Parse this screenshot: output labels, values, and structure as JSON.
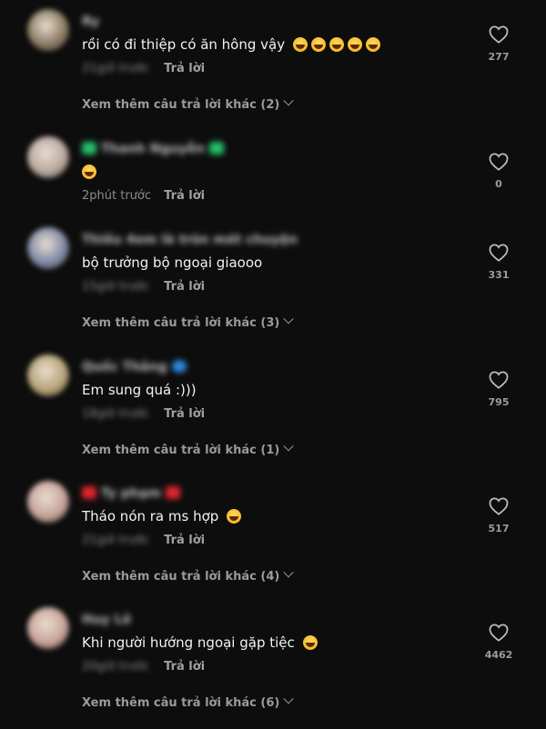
{
  "ui": {
    "reply_label": "Trả lời"
  },
  "comments": [
    {
      "author": "Ry",
      "text": "rồi có đi thiệp có ăn hông vậy",
      "emoji_count": 5,
      "time": "21giờ trước",
      "time_blurred": true,
      "likes": "277",
      "more_replies": "Xem thêm câu trả lời khác (2)",
      "avatar_color": "#8a7a62",
      "badges": []
    },
    {
      "author": "Thanh Nguyễn",
      "text": "",
      "emoji_count": 1,
      "time": "2phút trước",
      "time_blurred": false,
      "likes": "0",
      "more_replies": "",
      "avatar_color": "#b9a89f",
      "badges": [
        "#26c06a",
        "#26c06a"
      ]
    },
    {
      "author": "Thiều 4em là tròn mét chuyện",
      "text": "bộ trưởng bộ ngoại giaooo",
      "emoji_count": 0,
      "time": "15giờ trước",
      "time_blurred": true,
      "likes": "331",
      "more_replies": "Xem thêm câu trả lời khác (3)",
      "avatar_color": "#7d8aa8",
      "badges": []
    },
    {
      "author": "Quốc Thắng",
      "text": "Em sung quá :)))",
      "emoji_count": 0,
      "time": "18giờ trước",
      "time_blurred": true,
      "likes": "795",
      "more_replies": "Xem thêm câu trả lời khác (1)",
      "avatar_color": "#b6a477",
      "badges": [
        "#2d8ce0"
      ]
    },
    {
      "author": "Ty phạm",
      "text": "Tháo nón ra ms hợp",
      "emoji_count": 1,
      "time": "21giờ trước",
      "time_blurred": true,
      "likes": "517",
      "more_replies": "Xem thêm câu trả lời khác (4)",
      "avatar_color": "#c7a39a",
      "badges": [
        "#e0262f",
        "#e0262f"
      ]
    },
    {
      "author": "Huy Lê",
      "text": "Khi người hướng ngoại gặp tiệc",
      "emoji_count": 1,
      "time": "20giờ trước",
      "time_blurred": true,
      "likes": "4462",
      "more_replies": "Xem thêm câu trả lời khác (6)",
      "avatar_color": "#c9a49a",
      "badges": []
    }
  ]
}
